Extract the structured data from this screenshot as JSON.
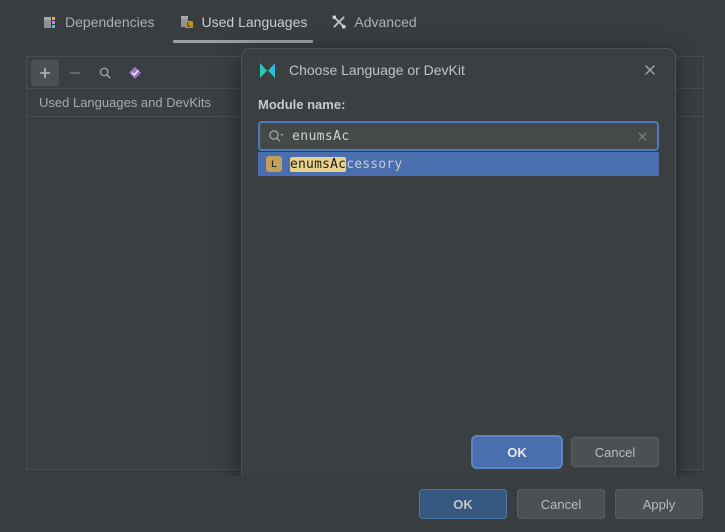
{
  "window": {
    "tabs": [
      {
        "label": "Dependencies",
        "icon": "module-dependencies-icon",
        "active": false
      },
      {
        "label": "Used Languages",
        "icon": "used-languages-icon",
        "active": true
      },
      {
        "label": "Advanced",
        "icon": "tools-icon",
        "active": false
      }
    ],
    "toolbar": [
      {
        "name": "add-button",
        "icon": "plus-icon",
        "pressed": true
      },
      {
        "name": "remove-button",
        "icon": "minus-icon",
        "pressed": false
      },
      {
        "name": "find-button",
        "icon": "search-icon",
        "pressed": false
      },
      {
        "name": "edit-button",
        "icon": "diamond-check-icon",
        "pressed": false
      }
    ],
    "list_header": "Used Languages and DevKits",
    "buttons": {
      "ok": "OK",
      "cancel": "Cancel",
      "apply": "Apply"
    }
  },
  "dialog": {
    "title": "Choose Language or DevKit",
    "title_icon": "jetbrains-logo-icon",
    "close_icon": "close-icon",
    "field_label": "Module name:",
    "search": {
      "icon": "search-dropdown-icon",
      "value": "enumsAc",
      "clear_icon": "clear-icon"
    },
    "results": [
      {
        "badge": "L",
        "badge_icon": "language-badge-icon",
        "match": "enumsAc",
        "rest": "cessory",
        "selected": true
      }
    ],
    "buttons": {
      "ok": "OK",
      "cancel": "Cancel"
    }
  },
  "colors": {
    "window_bg": "#3a3d3f",
    "panel_bg": "#3c3f41",
    "accent_blue": "#4b6eaf",
    "primary_button": "#365880",
    "focus_ring": "#4a7dbd",
    "match_highlight": "#e9d18c",
    "badge_gold": "#c2a05a"
  }
}
